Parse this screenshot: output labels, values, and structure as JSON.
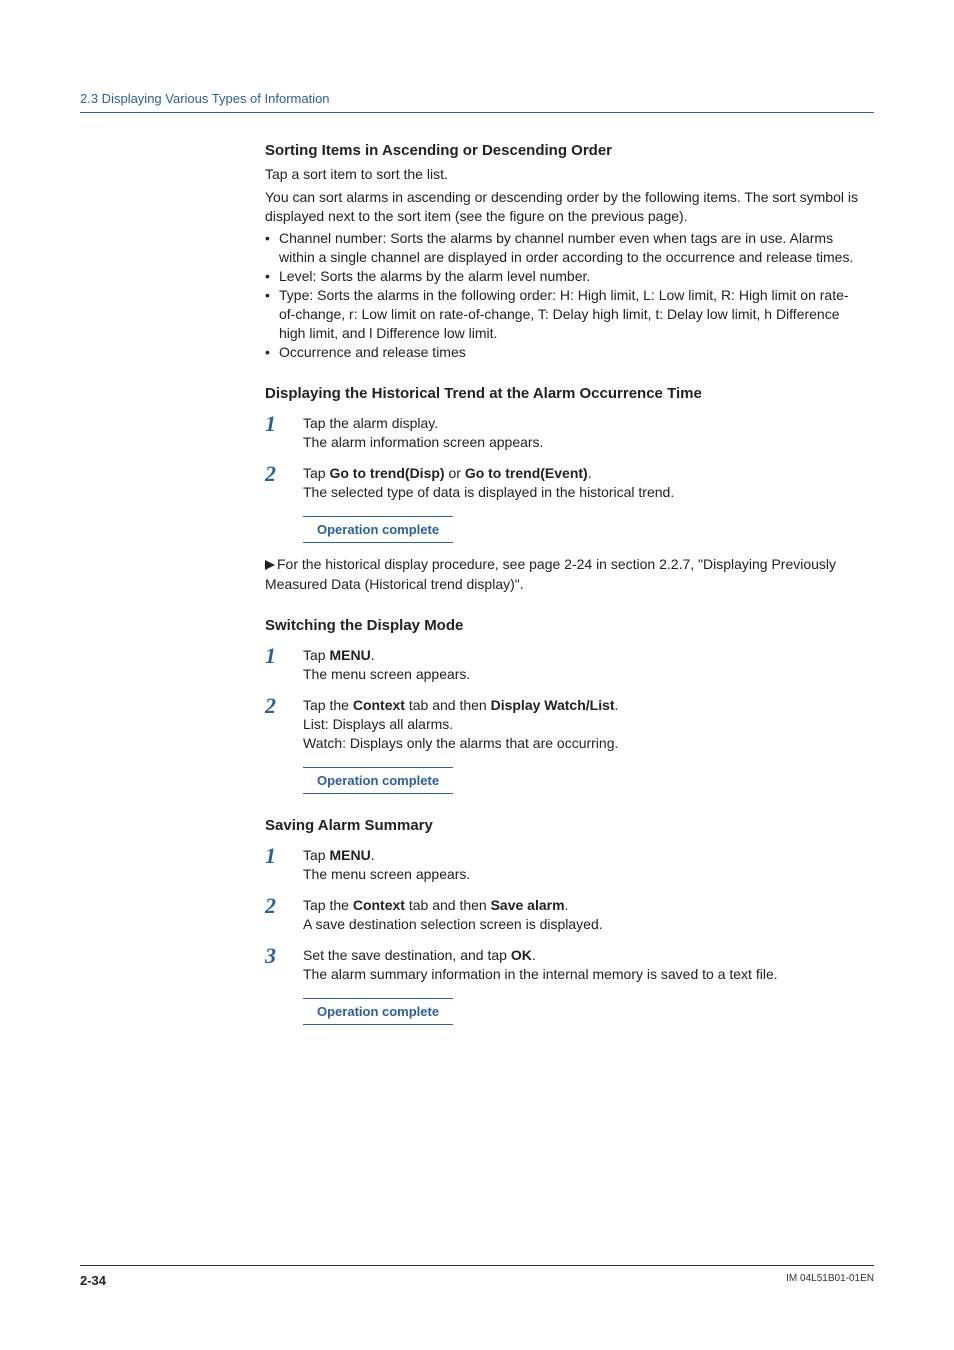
{
  "header": {
    "breadcrumb": "2.3  Displaying Various Types of Information"
  },
  "sec_sort": {
    "title": "Sorting Items in Ascending or Descending Order",
    "intro1": "Tap a sort item to sort the list.",
    "intro2": "You can sort alarms in ascending or descending order by the following items. The sort symbol is displayed next to the sort item (see the figure on the previous page).",
    "bullets": [
      "Channel number: Sorts the alarms by channel number even when tags are in use. Alarms within a single channel are displayed in order according to the occurrence and release times.",
      "Level: Sorts the alarms by the alarm level number.",
      "Type: Sorts the alarms in the following order: H: High limit, L: Low limit, R: High limit on rate-of-change, r: Low limit on rate-of-change, T: Delay high limit, t: Delay low limit, h Difference high limit, and l Difference low limit.",
      "Occurrence and release times"
    ]
  },
  "sec_hist": {
    "title": "Displaying the Historical Trend at the Alarm Occurrence Time",
    "step1_a": "Tap the alarm display.",
    "step1_b": "The alarm information screen appears.",
    "step2_pre": "Tap ",
    "step2_bold1": "Go to trend(Disp)",
    "step2_mid": " or ",
    "step2_bold2": "Go to trend(Event)",
    "step2_post": ".",
    "step2_sub": "The selected type of data is displayed in the historical trend.",
    "operation_complete": "Operation complete",
    "xref": "For the historical display procedure, see page 2-24 in section 2.2.7, \"Displaying Previously Measured Data (Historical trend display)\"."
  },
  "sec_switch": {
    "title": "Switching the Display Mode",
    "step1_pre": "Tap ",
    "step1_bold": "MENU",
    "step1_post": ".",
    "step1_sub": "The menu screen appears.",
    "step2_pre": "Tap the ",
    "step2_bold1": "Context",
    "step2_mid": " tab and then ",
    "step2_bold2": "Display Watch/List",
    "step2_post": ".",
    "step2_sub1": "List: Displays all alarms.",
    "step2_sub2": "Watch: Displays only the alarms that are occurring.",
    "operation_complete": "Operation complete"
  },
  "sec_save": {
    "title": "Saving Alarm Summary",
    "step1_pre": "Tap ",
    "step1_bold": "MENU",
    "step1_post": ".",
    "step1_sub": "The menu screen appears.",
    "step2_pre": "Tap the ",
    "step2_bold1": "Context",
    "step2_mid": " tab and then ",
    "step2_bold2": "Save alarm",
    "step2_post": ".",
    "step2_sub": "A save destination selection screen is displayed.",
    "step3_pre": "Set the save destination, and tap ",
    "step3_bold": "OK",
    "step3_post": ".",
    "step3_sub": "The alarm summary information in the internal memory is saved to a text file.",
    "operation_complete": "Operation complete"
  },
  "footer": {
    "page_number": "2-34",
    "doc_id": "IM 04L51B01-01EN"
  },
  "step_numbers": {
    "n1": "1",
    "n2": "2",
    "n3": "3"
  }
}
